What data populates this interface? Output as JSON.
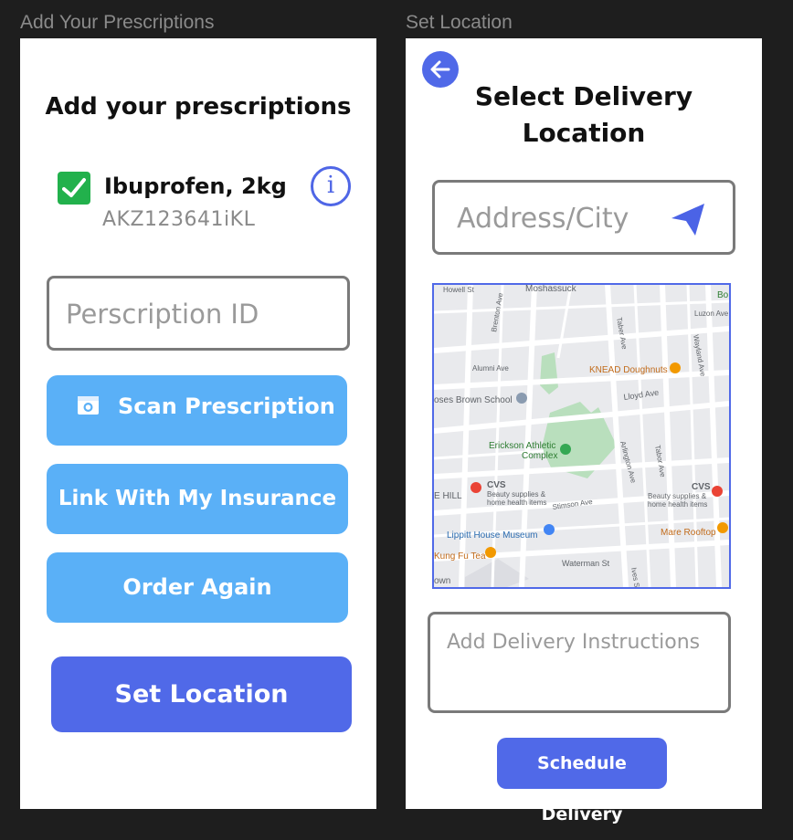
{
  "frames": {
    "left_label": "Add Your Prescriptions",
    "right_label": "Set Location"
  },
  "prescriptions": {
    "title": "Add your prescriptions",
    "item": {
      "name": "Ibuprofen, 2kg",
      "code": "AKZ123641iKL",
      "checked": true
    },
    "id_placeholder": "Perscription ID",
    "scan_label": "Scan Prescription",
    "insurance_label": "Link With My Insurance",
    "order_again_label": "Order Again",
    "set_location_label": "Set Location"
  },
  "location": {
    "title_line1": "Select Delivery",
    "title_line2": "Location",
    "address_placeholder": "Address/City",
    "instructions_placeholder": "Add Delivery Instructions",
    "schedule_label": "Schedule Delivery",
    "map": {
      "places": [
        "Moshassuck",
        "Howell St",
        "Brenton Ave",
        "Taber Ave",
        "Luzon Ave",
        "Wayland Ave",
        "Alumni Ave",
        "KNEAD Doughnuts",
        "oses Brown School",
        "Lloyd Ave",
        "Erickson Athletic",
        "Complex",
        "Arlington Ave",
        "Tabor Ave",
        "CVS",
        "Beauty supplies &",
        "home health items",
        "E HILL",
        "Stimson Ave",
        "Mare Rooftop",
        "Lippitt House Museum",
        "Kung Fu Tea",
        "Waterman St",
        "own",
        "Ives St",
        "Bo"
      ]
    }
  },
  "colors": {
    "background": "#1e1e1e",
    "primary": "#5069e8",
    "light_button": "#5ab0f7",
    "check": "#22b14c",
    "park": "#b9dfbd"
  },
  "icons": [
    "check-icon",
    "info-icon",
    "camera-icon",
    "back-arrow-icon",
    "navigation-arrow-icon",
    "map-pin-icon"
  ]
}
